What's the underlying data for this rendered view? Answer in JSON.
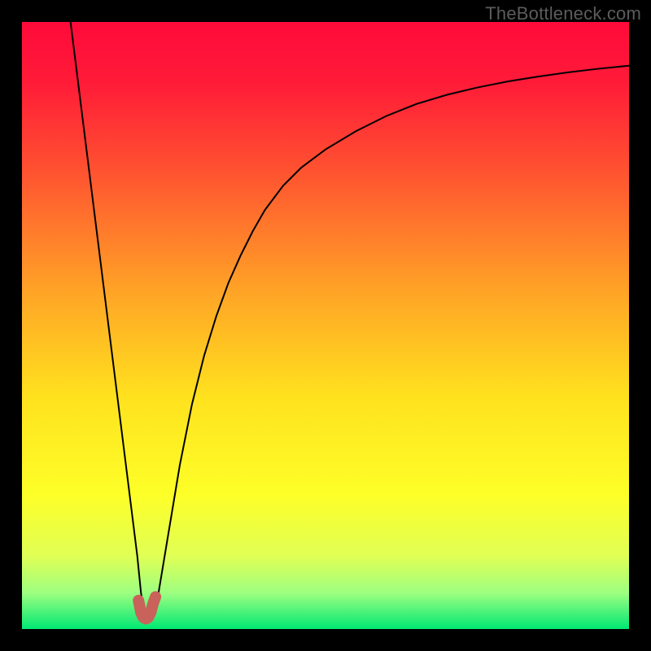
{
  "watermark": "TheBottleneck.com",
  "chart_data": {
    "type": "line",
    "title": "",
    "xlabel": "",
    "ylabel": "",
    "xlim": [
      0,
      100
    ],
    "ylim": [
      0,
      100
    ],
    "gradient_stops": [
      {
        "offset": 0.0,
        "color": "#ff0a3a"
      },
      {
        "offset": 0.1,
        "color": "#ff1b38"
      },
      {
        "offset": 0.25,
        "color": "#ff5430"
      },
      {
        "offset": 0.45,
        "color": "#ffa626"
      },
      {
        "offset": 0.62,
        "color": "#ffe21e"
      },
      {
        "offset": 0.78,
        "color": "#fdff28"
      },
      {
        "offset": 0.88,
        "color": "#e0ff55"
      },
      {
        "offset": 0.94,
        "color": "#9fff80"
      },
      {
        "offset": 1.0,
        "color": "#00e874"
      }
    ],
    "series": [
      {
        "name": "bottleneck-curve",
        "color": "#000000",
        "width": 2.0,
        "x": [
          8.0,
          9.0,
          10.0,
          11.0,
          12.0,
          13.0,
          14.0,
          15.0,
          16.0,
          17.0,
          17.5,
          18.0,
          18.5,
          19.0,
          19.3,
          19.6,
          20.0,
          20.5,
          21.0,
          21.5,
          22.0,
          22.5,
          23.0,
          24.0,
          25.0,
          26.0,
          27.0,
          28.0,
          30.0,
          32.0,
          34.0,
          36.0,
          38.0,
          40.0,
          43.0,
          46.0,
          50.0,
          55.0,
          60.0,
          65.0,
          70.0,
          75.0,
          80.0,
          85.0,
          90.0,
          95.0,
          100.0
        ],
        "y": [
          100.0,
          92.0,
          84.0,
          76.0,
          68.0,
          60.0,
          52.0,
          44.0,
          36.0,
          28.0,
          24.0,
          20.0,
          16.0,
          12.0,
          9.0,
          6.0,
          3.5,
          2.0,
          1.5,
          2.0,
          3.5,
          6.0,
          9.0,
          15.0,
          21.0,
          27.0,
          32.0,
          37.0,
          45.0,
          51.5,
          57.0,
          61.5,
          65.5,
          69.0,
          73.0,
          76.0,
          79.0,
          82.0,
          84.5,
          86.5,
          88.0,
          89.2,
          90.2,
          91.0,
          91.7,
          92.3,
          92.8
        ]
      },
      {
        "name": "marker-blob",
        "color": "#c9625a",
        "width": 14,
        "x": [
          19.2,
          19.6,
          20.0,
          20.4,
          20.8,
          21.2,
          21.6,
          22.0
        ],
        "y": [
          4.7,
          2.7,
          1.9,
          1.7,
          1.9,
          2.7,
          4.2,
          5.3
        ]
      }
    ]
  }
}
